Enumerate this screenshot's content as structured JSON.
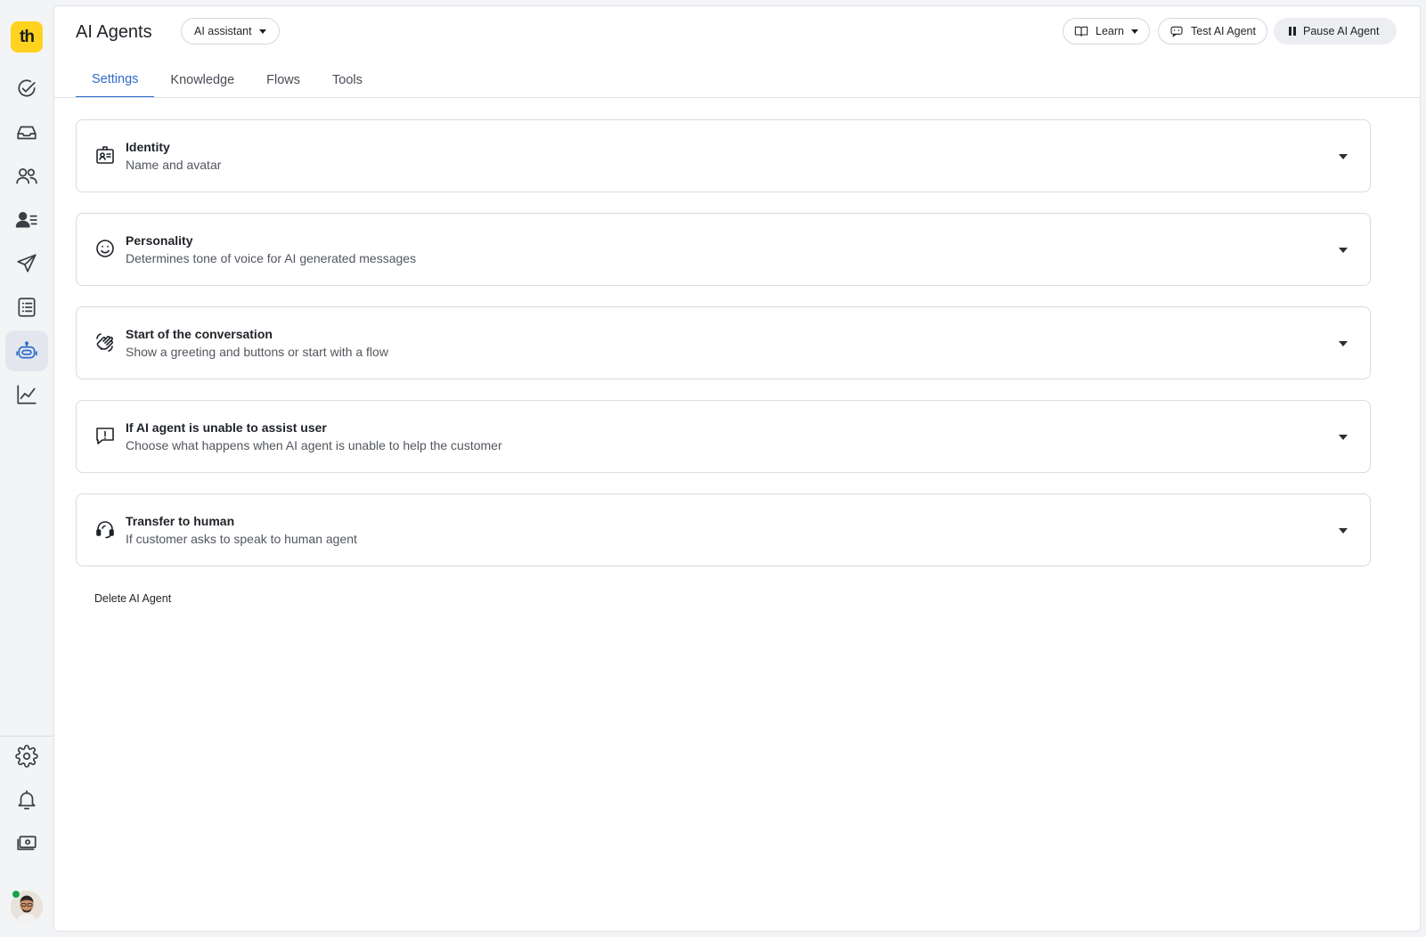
{
  "app": {
    "logo_text": "th"
  },
  "header": {
    "title": "AI Agents",
    "agent_selector": "AI assistant",
    "learn_label": "Learn",
    "test_label": "Test AI Agent",
    "pause_label": "Pause AI Agent"
  },
  "tabs": [
    {
      "label": "Settings",
      "active": true
    },
    {
      "label": "Knowledge",
      "active": false
    },
    {
      "label": "Flows",
      "active": false
    },
    {
      "label": "Tools",
      "active": false
    }
  ],
  "sections": [
    {
      "title": "Identity",
      "subtitle": "Name and avatar",
      "icon": "id-badge-icon"
    },
    {
      "title": "Personality",
      "subtitle": "Determines tone of voice for AI generated messages",
      "icon": "smiley-icon"
    },
    {
      "title": "Start of the conversation",
      "subtitle": "Show a greeting and buttons or start with a flow",
      "icon": "waving-hands-icon"
    },
    {
      "title": "If AI agent is unable to assist user",
      "subtitle": "Choose what happens when AI agent is unable to help the customer",
      "icon": "alert-message-icon"
    },
    {
      "title": "Transfer to human",
      "subtitle": "If customer asks to speak to human agent",
      "icon": "headset-icon"
    }
  ],
  "footer": {
    "delete_label": "Delete AI Agent"
  },
  "sidebar": {
    "items": [
      "check-circle-icon",
      "inbox-icon",
      "users-icon",
      "contacts-icon",
      "send-icon",
      "list-icon",
      "robot-icon",
      "chart-icon"
    ],
    "active_item": "robot-icon",
    "bottom_items": [
      "gear-icon",
      "bell-icon",
      "billing-icon"
    ]
  },
  "colors": {
    "accent": "#2f6bcc",
    "logo": "#ffd21f",
    "presence": "#17a34a"
  }
}
